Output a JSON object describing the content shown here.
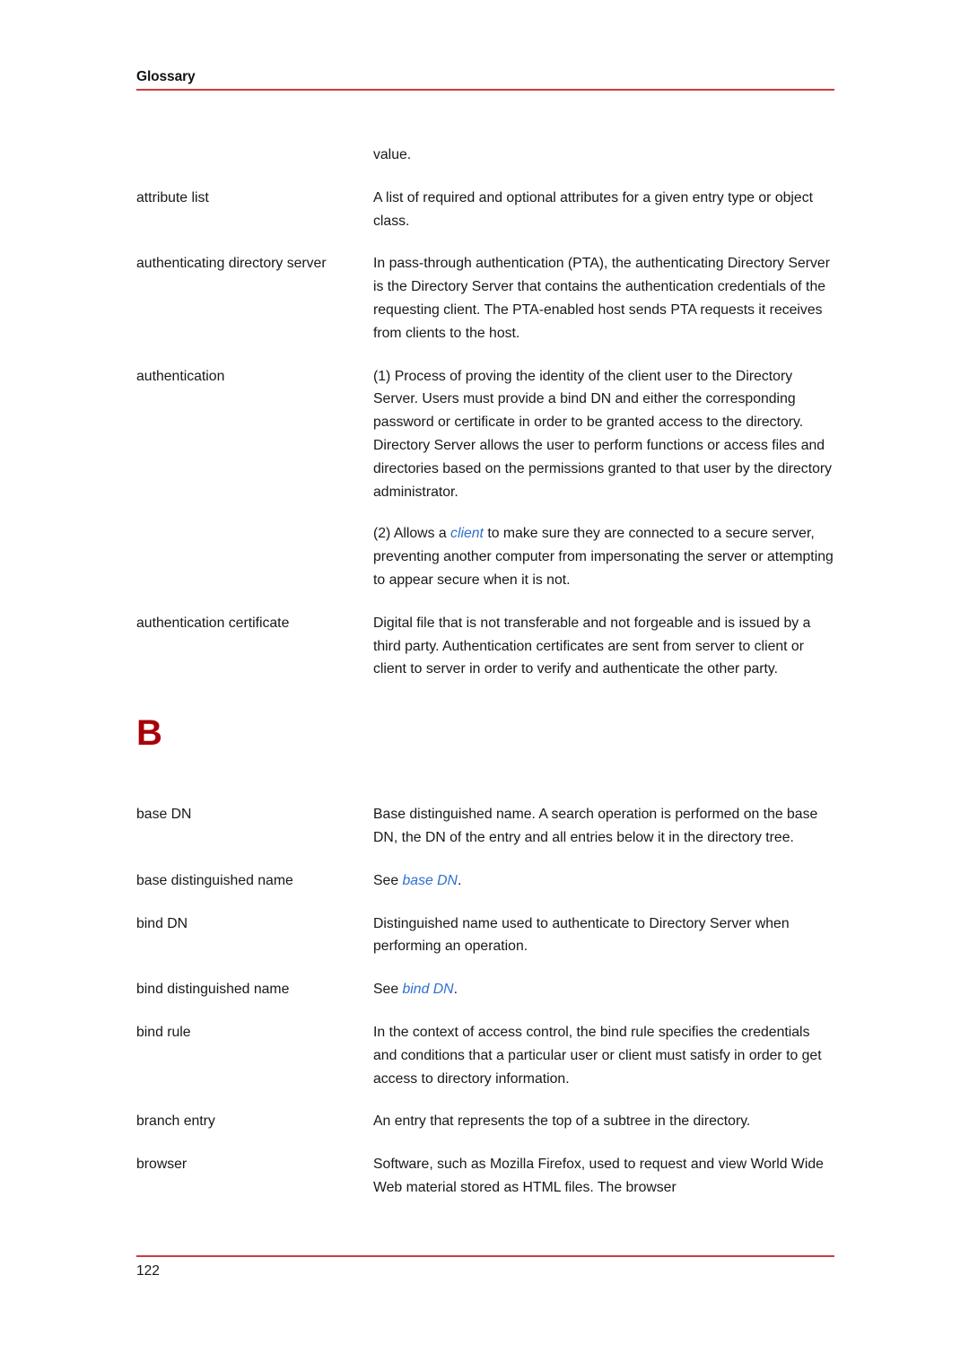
{
  "header": {
    "title": "Glossary",
    "rule_color": "#ce3b3b"
  },
  "colors": {
    "rule_red": "#ce3b3b",
    "section_letter_red": "#a80008",
    "xref_blue": "#2f6fd0",
    "body_text": "#18181a",
    "page_background": "#ffffff"
  },
  "continued_line": "value.",
  "entries_a": [
    {
      "term": "attribute list",
      "paragraphs": [
        [
          {
            "text": "A list of required and optional attributes for a given entry type or object class."
          }
        ]
      ]
    },
    {
      "term": "authenticating directory server",
      "paragraphs": [
        [
          {
            "text": "In pass-through authentication (PTA), the authenticating Directory Server is the Directory Server that contains the authentication credentials of the requesting client. The PTA-enabled host sends PTA requests it receives from clients to the host."
          }
        ]
      ]
    },
    {
      "term": "authentication",
      "paragraphs": [
        [
          {
            "text": "(1) Process of proving the identity of the client user to the Directory Server. Users must provide a bind DN and either the corresponding password or certificate in order to be granted access to the directory. Directory Server allows the user to perform functions or access files and directories based on the permissions granted to that user by the directory administrator."
          }
        ],
        [
          {
            "text": "(2) Allows a "
          },
          {
            "text": "client",
            "xref": true
          },
          {
            "text": " to make sure they are connected to a secure server, preventing another computer from impersonating the server or attempting to appear secure when it is not."
          }
        ]
      ]
    },
    {
      "term": "authentication certificate",
      "paragraphs": [
        [
          {
            "text": "Digital file that is not transferable and not forgeable and is issued by a third party. Authentication certificates are sent from server to client or client to server in order to verify and authenticate the other party."
          }
        ]
      ]
    }
  ],
  "section_letter": "B",
  "entries_b": [
    {
      "term": "base DN",
      "paragraphs": [
        [
          {
            "text": "Base distinguished name. A search operation is performed on the base DN, the DN of the entry and all entries below it in the directory tree."
          }
        ]
      ]
    },
    {
      "term": "base distinguished name",
      "paragraphs": [
        [
          {
            "text": "See "
          },
          {
            "text": "base DN",
            "xref": true
          },
          {
            "text": "."
          }
        ]
      ]
    },
    {
      "term": "bind DN",
      "paragraphs": [
        [
          {
            "text": "Distinguished name used to authenticate to Directory Server when performing an operation."
          }
        ]
      ]
    },
    {
      "term": "bind distinguished name",
      "paragraphs": [
        [
          {
            "text": "See "
          },
          {
            "text": "bind DN",
            "xref": true
          },
          {
            "text": "."
          }
        ]
      ]
    },
    {
      "term": "bind rule",
      "paragraphs": [
        [
          {
            "text": "In the context of access control, the bind rule specifies the credentials and conditions that a particular user or client must satisfy in order to get access to directory information."
          }
        ]
      ]
    },
    {
      "term": "branch entry",
      "paragraphs": [
        [
          {
            "text": "An entry that represents the top of a subtree in the directory."
          }
        ]
      ]
    },
    {
      "term": "browser",
      "paragraphs": [
        [
          {
            "text": "Software, such as Mozilla Firefox, used to request and view World Wide Web material stored as HTML files. The browser"
          }
        ]
      ]
    }
  ],
  "footer": {
    "page_number": "122"
  }
}
